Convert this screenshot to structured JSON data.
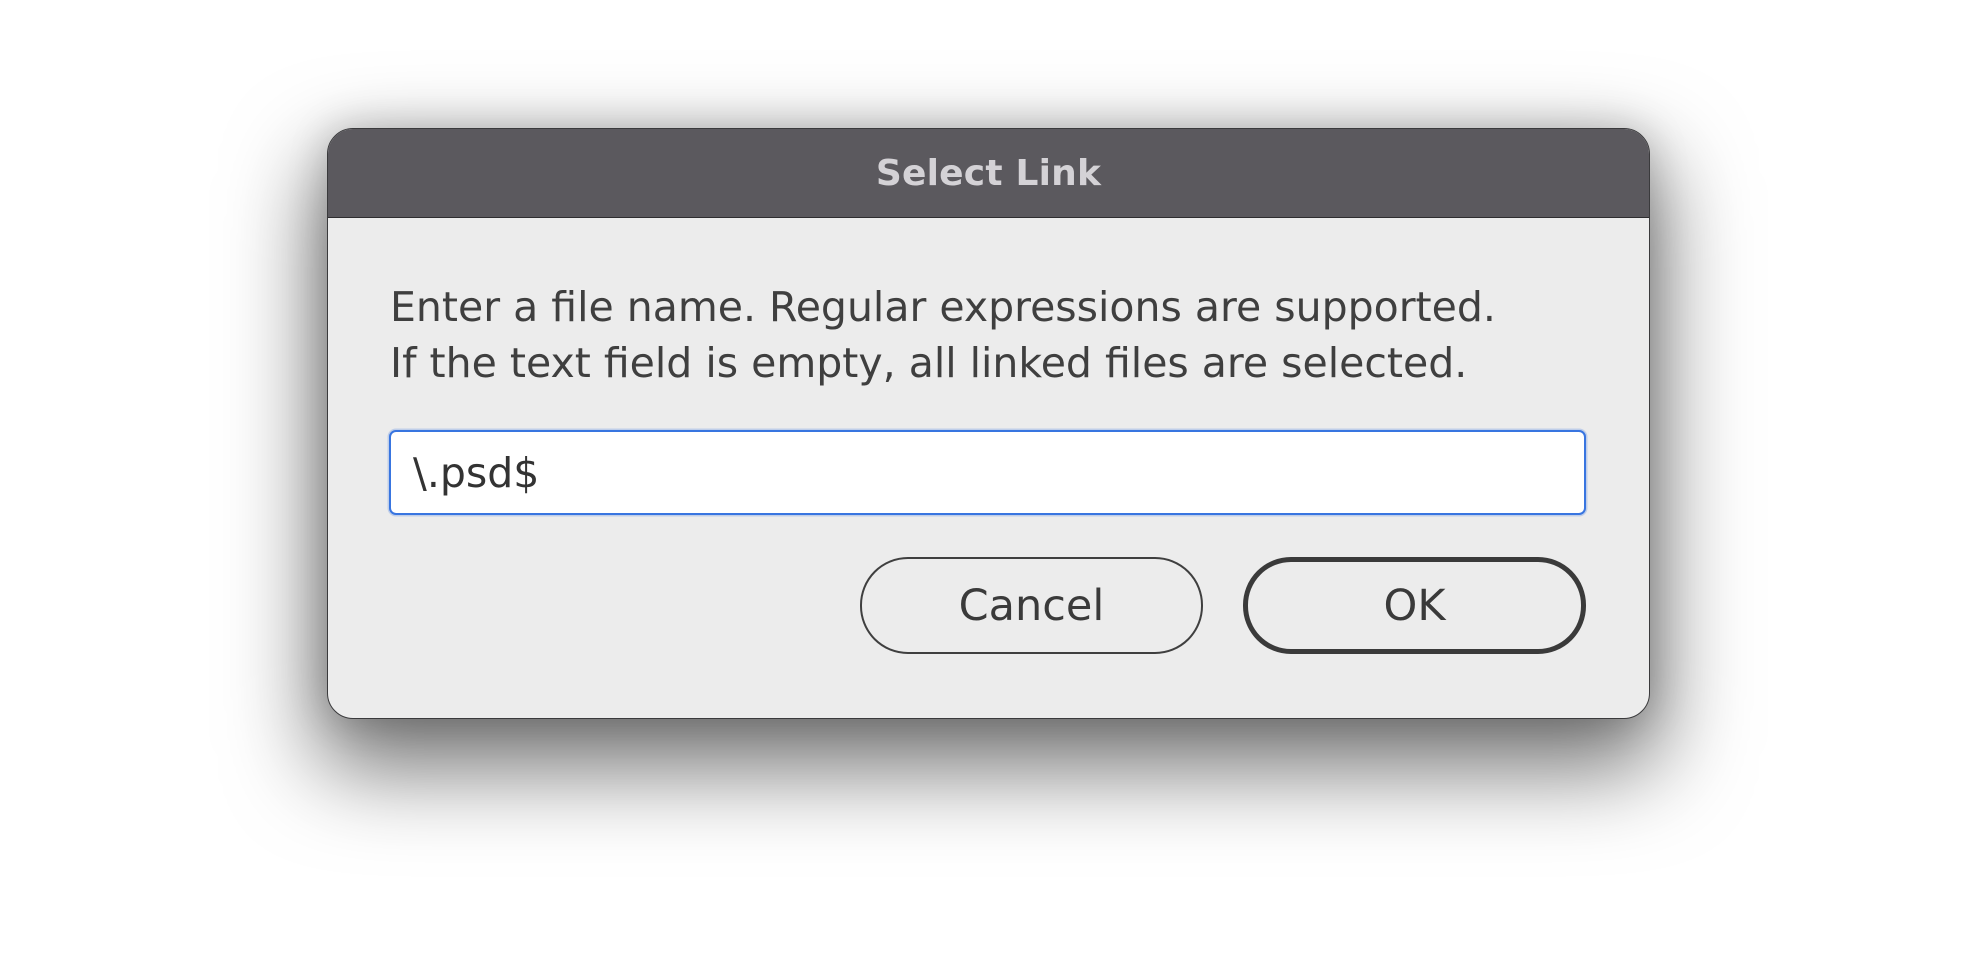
{
  "dialog": {
    "title": "Select Link",
    "message_lines": [
      "Enter a file name. Regular expressions are supported.",
      "If the text field is empty, all linked files are selected."
    ],
    "input_value": "\\.psd$",
    "cancel_label": "Cancel",
    "ok_label": "OK"
  },
  "colors": {
    "titlebar": "#5b595e",
    "body": "#ececec",
    "focus_ring": "#3875e0"
  }
}
